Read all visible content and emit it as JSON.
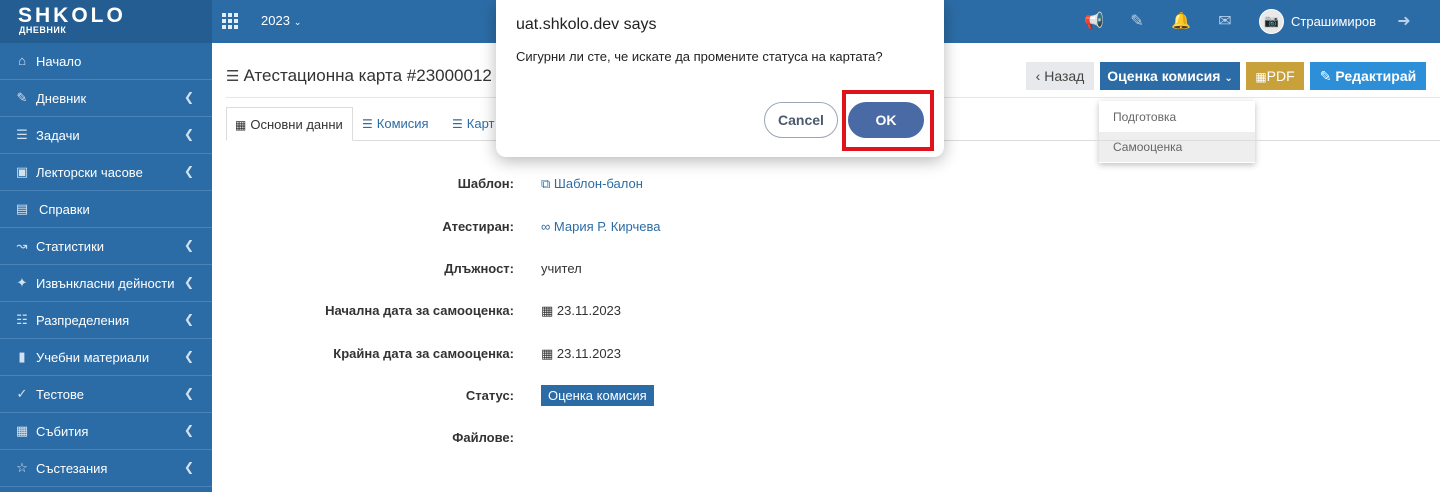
{
  "topbar": {
    "logo_main": "SHKOLO",
    "logo_sub": "ДНЕВНИК",
    "year": "2023",
    "username": "Страшимиров",
    "icons": [
      "megaphone-icon",
      "edit-icon",
      "bell-icon",
      "envelope-icon",
      "avatar",
      "logout-icon"
    ]
  },
  "sidebar": {
    "items": [
      {
        "label": "Начало",
        "icon": "home-icon",
        "chevron": false
      },
      {
        "label": "Дневник",
        "icon": "notebook-icon",
        "chevron": true
      },
      {
        "label": "Задачи",
        "icon": "tasks-icon",
        "chevron": true
      },
      {
        "label": "Лекторски часове",
        "icon": "bus-icon",
        "chevron": true
      },
      {
        "label": "Справки",
        "icon": "report-icon",
        "chevron": false
      },
      {
        "label": "Статистики",
        "icon": "chart-icon",
        "chevron": true
      },
      {
        "label": "Извънкласни дейности",
        "icon": "runner-icon",
        "chevron": true
      },
      {
        "label": "Разпределения",
        "icon": "list-icon",
        "chevron": true
      },
      {
        "label": "Учебни материали",
        "icon": "books-icon",
        "chevron": true
      },
      {
        "label": "Тестове",
        "icon": "spellcheck-icon",
        "chevron": true
      },
      {
        "label": "Събития",
        "icon": "calendar-icon",
        "chevron": true
      },
      {
        "label": "Състезания",
        "icon": "trophy-icon",
        "chevron": true
      }
    ]
  },
  "page": {
    "title": "Атестационна карта #23000012",
    "back_label": "Назад",
    "status_label": "Оценка комисия",
    "pdf_label": "PDF",
    "edit_label": "Редактирай"
  },
  "status_dropdown": {
    "items": [
      {
        "label": "Подготовка"
      },
      {
        "label": "Самооценка",
        "active": true
      }
    ]
  },
  "tabs": [
    {
      "label": "Основни данни",
      "active": true
    },
    {
      "label": "Комисия"
    },
    {
      "label": "Карт"
    }
  ],
  "fields": [
    {
      "label": "Шаблон:",
      "value": "Шаблон-балон"
    },
    {
      "label": "Атестиран:",
      "value": "Мария Р. Кирчева"
    },
    {
      "label": "Длъжност:",
      "value": "учител"
    },
    {
      "label": "Начална дата за самооценка:",
      "value": "23.11.2023"
    },
    {
      "label": "Крайна дата за самооценка:",
      "value": "23.11.2023"
    },
    {
      "label": "Статус:",
      "value": "Оценка комисия"
    },
    {
      "label": "Файлове:",
      "value": ""
    }
  ],
  "dialog": {
    "title": "uat.shkolo.dev says",
    "message": "Сигурни ли сте, че искате да промените статуса на картата?",
    "cancel_label": "Cancel",
    "ok_label": "OK"
  },
  "colors": {
    "primary": "#2c6ca6",
    "pdf": "#c9a13a",
    "edit": "#2d8fd8",
    "highlight": "#e0121a"
  }
}
